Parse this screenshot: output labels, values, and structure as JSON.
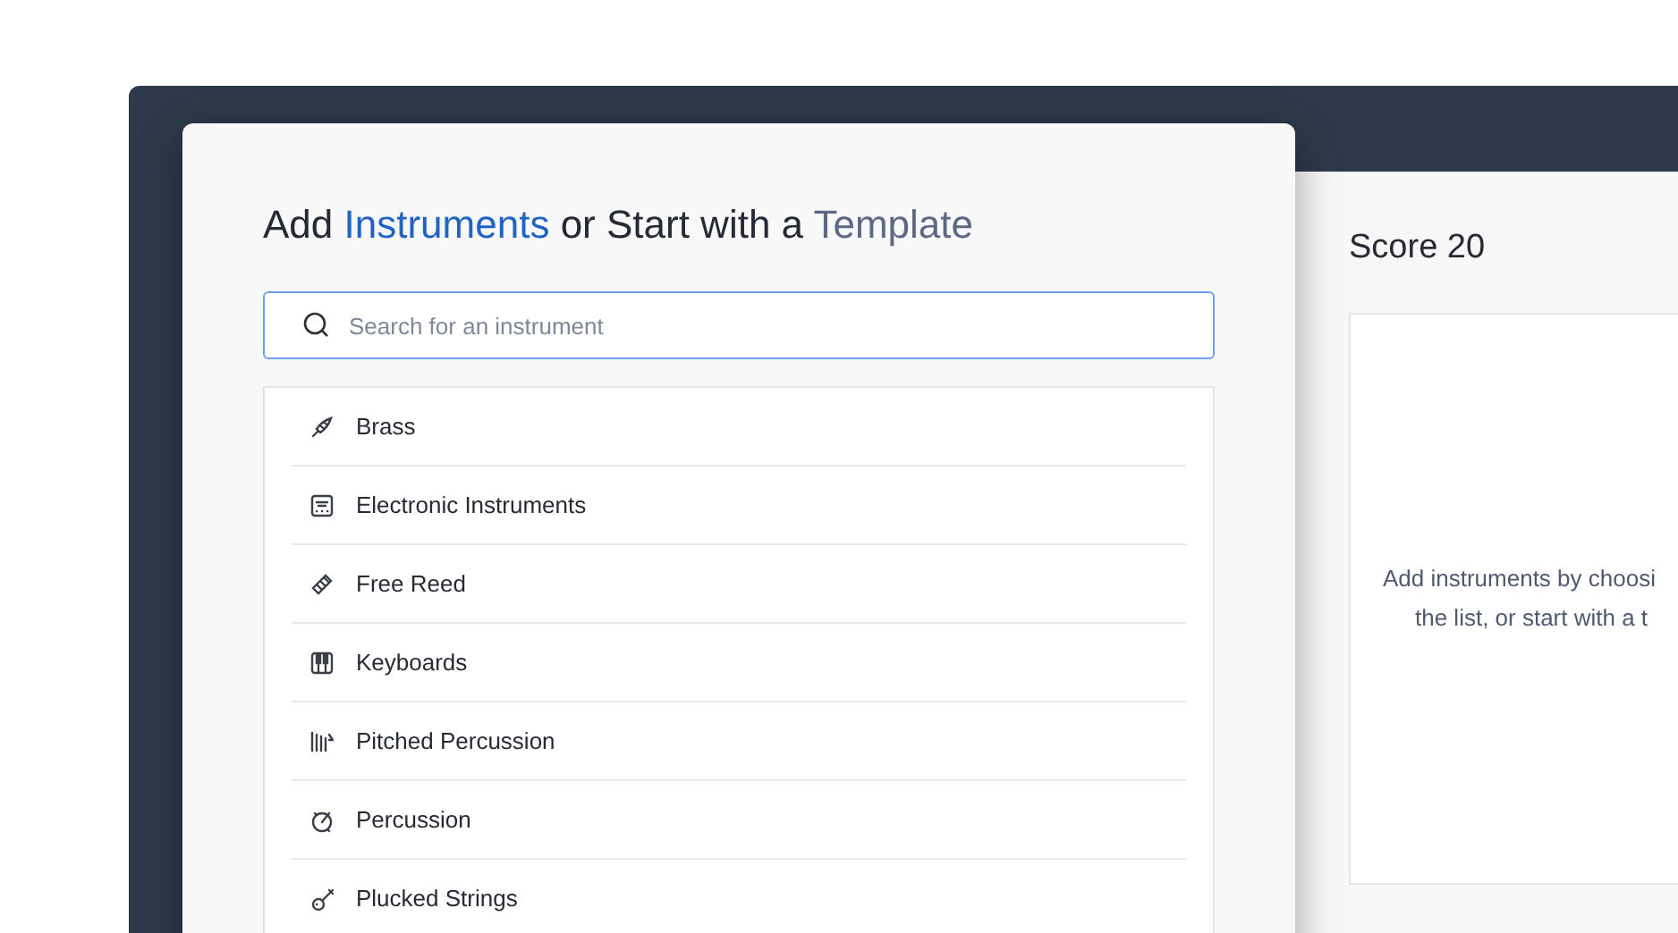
{
  "dialog": {
    "title": [
      {
        "text": "Add ",
        "color": "#252a35"
      },
      {
        "text": "Instruments",
        "color": "#1f63c4"
      },
      {
        "text": " or Start with a ",
        "color": "#252a35"
      },
      {
        "text": "Template",
        "color": "#5c6884"
      }
    ],
    "search": {
      "placeholder": "Search for an instrument"
    },
    "families": [
      {
        "label": "Brass",
        "kind": "brass"
      },
      {
        "label": "Electronic Instruments",
        "kind": "electronic"
      },
      {
        "label": "Free Reed",
        "kind": "reed"
      },
      {
        "label": "Keyboards",
        "kind": "keyboard"
      },
      {
        "label": "Pitched Percussion",
        "kind": "pitched"
      },
      {
        "label": "Percussion",
        "kind": "percussion"
      },
      {
        "label": "Plucked Strings",
        "kind": "plucked"
      }
    ]
  },
  "score": {
    "title": "Score 20",
    "hint_lines": [
      "Add instruments by choosi",
      "the list, or start with a t"
    ]
  }
}
